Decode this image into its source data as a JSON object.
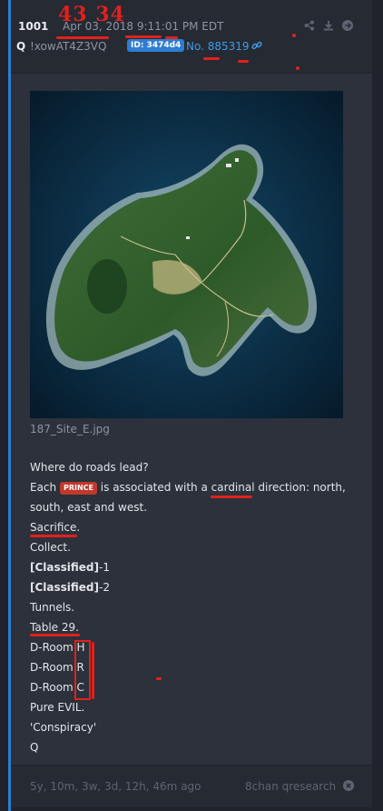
{
  "post": {
    "number": "1001",
    "date": "Apr 03, 2018 9:11:01 PM EDT",
    "author": "Q",
    "tripcode": "!xowAT4Z3VQ",
    "id_badge": "ID: 3474d4",
    "post_no": "No. 885319"
  },
  "handwritten_note": "43 34",
  "image": {
    "filename": "187_Site_E.jpg"
  },
  "body": {
    "line1": "Where do roads lead?",
    "line2_pre": "Each ",
    "tag": "PRINCE",
    "line2_post": " is associated with a cardinal direction: north, south, east and west.",
    "line3": "Sacrifice.",
    "line4": "Collect.",
    "line5_bold": "[Classified]",
    "line5_rest": "-1",
    "line6_bold": "[Classified]",
    "line6_rest": "-2",
    "line7": "Tunnels.",
    "line8": "Table 29.",
    "line9": "D-Room H",
    "line10": "D-Room R",
    "line11": "D-Room C",
    "line12": "Pure EVIL.",
    "line13": "'Conspiracy'",
    "line14": "Q"
  },
  "footer": {
    "ago": "5y, 10m, 3w, 3d, 12h, 46m ago",
    "board": "8chan qresearch"
  },
  "colors": {
    "accent": "#2a7fd0",
    "link": "#4199e8",
    "annotation": "#e2211c",
    "tag": "#c0392b"
  },
  "icons": [
    "share-icon",
    "download-icon",
    "arrow-right-icon",
    "link-icon",
    "close-circle-icon"
  ]
}
